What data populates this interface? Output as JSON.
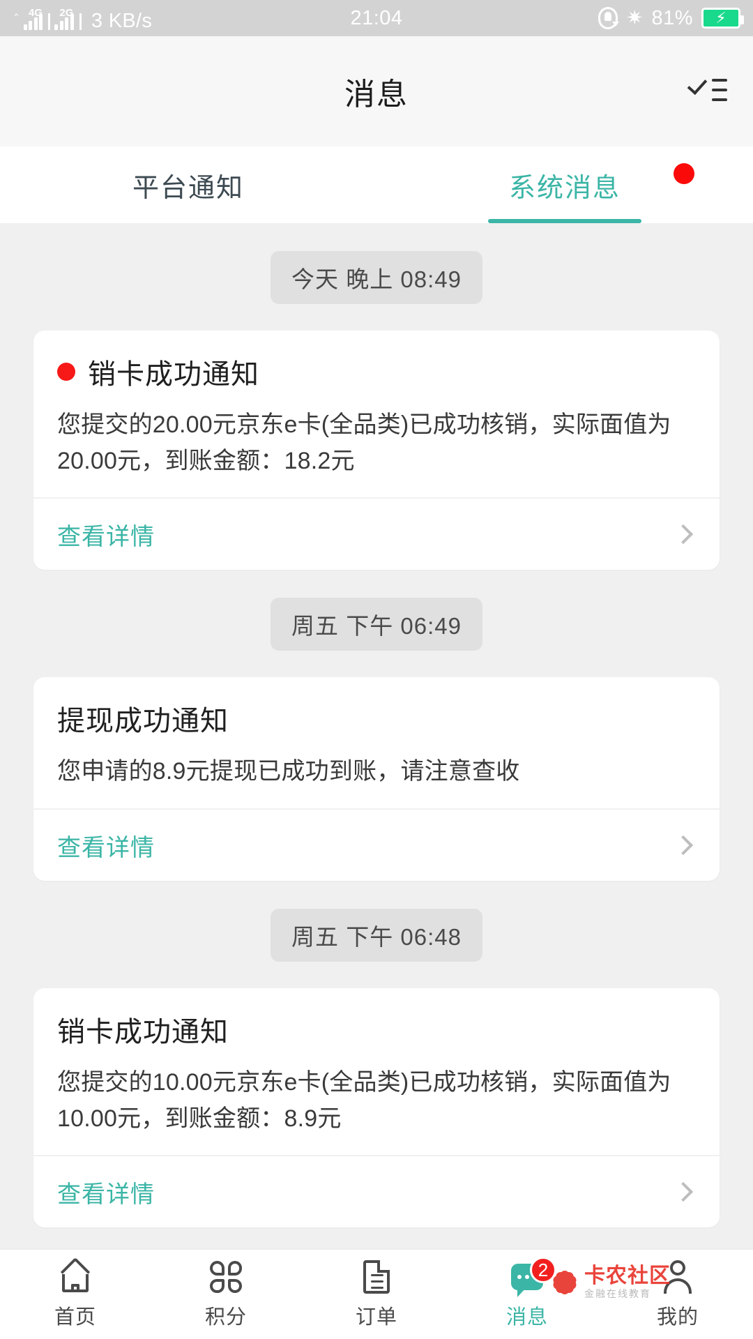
{
  "status_bar": {
    "network_4g": "4G",
    "network_2g": "2G",
    "net_speed": "3 KB/s",
    "time": "21:04",
    "battery_percent": "81%",
    "bluetooth_icon": "bluetooth-icon",
    "rotation_lock_icon": "rotation-lock-icon",
    "battery_icon": "battery-charging-icon",
    "colors": {
      "bar_bg": "#d3d3d3",
      "battery_green": "#19d98c"
    }
  },
  "header": {
    "title": "消息",
    "action_icon": "mark-all-read-icon"
  },
  "tabs": {
    "active_color": "#3bb5a6",
    "items": [
      {
        "label": "平台通知",
        "active": false,
        "has_badge": false
      },
      {
        "label": "系统消息",
        "active": true,
        "has_badge": true
      }
    ]
  },
  "messages": [
    {
      "timestamp": "今天 晚上 08:49",
      "title": "销卡成功通知",
      "unread": true,
      "text": "您提交的20.00元京东e卡(全品类)已成功核销，实际面值为20.00元，到账金额：18.2元",
      "footer_label": "查看详情"
    },
    {
      "timestamp": "周五 下午 06:49",
      "title": "提现成功通知",
      "unread": false,
      "text": "您申请的8.9元提现已成功到账，请注意查收",
      "footer_label": "查看详情"
    },
    {
      "timestamp": "周五 下午 06:48",
      "title": "销卡成功通知",
      "unread": false,
      "text": "您提交的10.00元京东e卡(全品类)已成功核销，实际面值为10.00元，到账金额：8.9元",
      "footer_label": "查看详情"
    }
  ],
  "bottom_nav": {
    "items": [
      {
        "label": "首页",
        "icon": "home-icon",
        "active": false,
        "badge": ""
      },
      {
        "label": "积分",
        "icon": "points-icon",
        "active": false,
        "badge": ""
      },
      {
        "label": "订单",
        "icon": "order-icon",
        "active": false,
        "badge": ""
      },
      {
        "label": "消息",
        "icon": "message-icon",
        "active": true,
        "badge": "2"
      },
      {
        "label": "我的",
        "icon": "profile-icon",
        "active": false,
        "badge": ""
      }
    ]
  },
  "watermark": {
    "main": "卡农社区",
    "sub": "金融在线教育"
  }
}
